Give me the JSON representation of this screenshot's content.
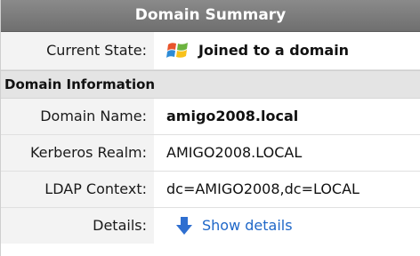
{
  "title": "Domain Summary",
  "current_state": {
    "label": "Current State:",
    "value": "Joined to a domain",
    "icon": "windows-flag-icon"
  },
  "section": "Domain Information",
  "rows": [
    {
      "label": "Domain Name:",
      "value": "amigo2008.local"
    },
    {
      "label": "Kerberos Realm:",
      "value": "AMIGO2008.LOCAL"
    },
    {
      "label": "LDAP Context:",
      "value": "dc=AMIGO2008,dc=LOCAL"
    }
  ],
  "details": {
    "label": "Details:",
    "link_text": "Show details",
    "icon": "down-arrow-icon",
    "link_color": "#1f67c8"
  },
  "colors": {
    "header_bg": "#7d7d7d",
    "label_bg": "#f3f3f3",
    "section_bg": "#e4e4e4"
  }
}
